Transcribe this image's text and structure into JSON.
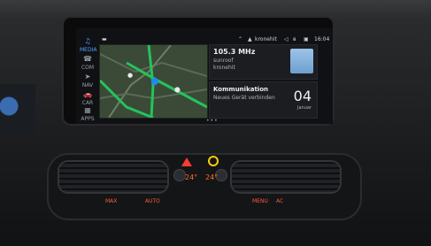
{
  "topbar": {
    "car_label": "",
    "channel": "kronehit",
    "time": "16:04"
  },
  "sidebar": {
    "items": [
      {
        "label": "MEDIA",
        "icon": "music-note-icon",
        "active": true
      },
      {
        "label": "COM",
        "icon": "phone-icon",
        "active": false
      },
      {
        "label": "NAV",
        "icon": "navigation-icon",
        "active": false
      },
      {
        "label": "CAR",
        "icon": "car-icon",
        "active": false
      },
      {
        "label": "APPS",
        "icon": "apps-grid-icon",
        "active": false
      }
    ]
  },
  "radio": {
    "frequency": "105.3 MHz",
    "provider": "sunroof",
    "station": "kronehit"
  },
  "communication": {
    "title": "Kommunikation",
    "subtitle": "Neues Gerät verbinden",
    "date_number": "04",
    "month": "Januar"
  },
  "climate": {
    "temp_left": "24°",
    "temp_right": "24°",
    "left_buttons": [
      "MAX",
      "AUTO"
    ],
    "right_buttons": [
      "MENU",
      "AC"
    ]
  },
  "colors": {
    "accent": "#4aa3ff",
    "climate_led": "#ff5a3d",
    "hazard": "#ff3b30"
  }
}
